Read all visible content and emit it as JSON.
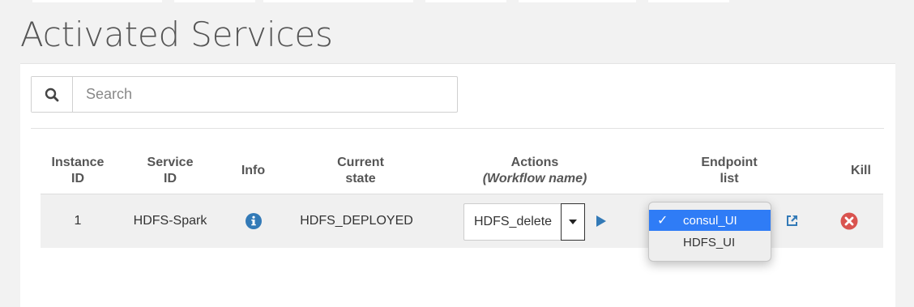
{
  "page": {
    "title": "Activated Services"
  },
  "search": {
    "placeholder": "Search",
    "icon": "search-icon"
  },
  "table": {
    "headers": {
      "instance_id": [
        "Instance",
        "ID"
      ],
      "service_id": [
        "Service",
        "ID"
      ],
      "info": "Info",
      "current_state": [
        "Current",
        "state"
      ],
      "actions": "Actions",
      "actions_sub": "(Workflow name)",
      "endpoint_list": [
        "Endpoint",
        "list"
      ],
      "kill": "Kill"
    },
    "rows": [
      {
        "instance_id": "1",
        "service_id": "HDFS-Spark",
        "current_state": "HDFS_DEPLOYED",
        "workflow": "HDFS_delete",
        "endpoints": [
          "consul_UI",
          "HDFS_UI"
        ],
        "selected_endpoint": "consul_UI"
      }
    ]
  },
  "dropdown": {
    "checkmark": "✓"
  },
  "colors": {
    "accent": "#337ab7",
    "kill": "#d9534f",
    "selection": "#2f7cf6"
  }
}
